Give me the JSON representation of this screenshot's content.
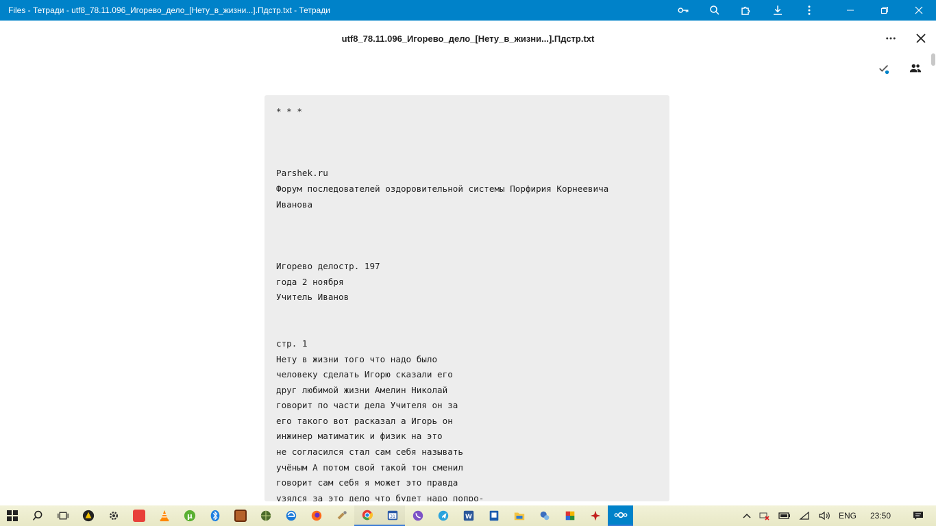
{
  "window": {
    "title": "Files - Тетради - utf8_78.11.096_Игорево_дело_[Нету_в_жизни...].Пдстр.txt - Тетради",
    "toolbar_icons": [
      "key-icon",
      "zoom-icon",
      "extension-icon",
      "download-icon",
      "more-vertical-icon"
    ],
    "controls": [
      "minimize-icon",
      "restore-icon",
      "close-icon"
    ]
  },
  "viewer": {
    "filename": "utf8_78.11.096_Игорево_дело_[Нету_в_жизни...].Пдстр.txt",
    "more_icon": "more-horizontal-icon",
    "close_icon": "close-icon",
    "side_icons": [
      "checkmark-icon",
      "people-icon"
    ]
  },
  "document": {
    "text": "* * *\n\n\n\nParshek.ru\nФорум последователей оздоровительной системы Порфирия Корнеевича\nИванова\n\n\n\nИгорево делостр. 197\nгода 2 ноября\nУчитель Иванов\n\n\nстр. 1\nНету в жизни того что надо было\nчеловеку сделать Игорю сказали его\nдруг любимой жизни Амелин Николай\nговорит по части дела Учителя он за\nего такого вот расказал а Игорь он\nинжинер матиматик и физик на это\nне согласился стал сам себя называть\nучёным А потом свой такой тон сменил\nговорит сам себя я может это правда\nузялся за это дело что будет надо попро-"
  },
  "taskbar": {
    "apps": [
      {
        "name": "start-icon"
      },
      {
        "name": "search-icon"
      },
      {
        "name": "task-view-icon"
      },
      {
        "name": "app-warning-icon"
      },
      {
        "name": "settings-icon"
      },
      {
        "name": "anydesk-icon"
      },
      {
        "name": "vlc-icon"
      },
      {
        "name": "utorrent-icon"
      },
      {
        "name": "bluetooth-icon"
      },
      {
        "name": "game-icon"
      },
      {
        "name": "globe-icon"
      },
      {
        "name": "edge-icon"
      },
      {
        "name": "firefox-icon"
      },
      {
        "name": "tool-icon"
      },
      {
        "name": "chrome-icon"
      },
      {
        "name": "calendar-icon"
      },
      {
        "name": "viber-icon"
      },
      {
        "name": "telegram-icon"
      },
      {
        "name": "word-icon"
      },
      {
        "name": "notes-icon"
      },
      {
        "name": "explorer-icon"
      },
      {
        "name": "network-app-icon"
      },
      {
        "name": "puzzle-app-icon"
      },
      {
        "name": "red-app-icon"
      },
      {
        "name": "nextcloud-icon"
      }
    ],
    "tray": {
      "language": "ENG",
      "time": "23:50"
    }
  },
  "colors": {
    "titlebar": "#0082c9",
    "document_bg": "#ededed",
    "taskbar_bg": "#efefd2",
    "accent_dot": "#0082c9"
  }
}
